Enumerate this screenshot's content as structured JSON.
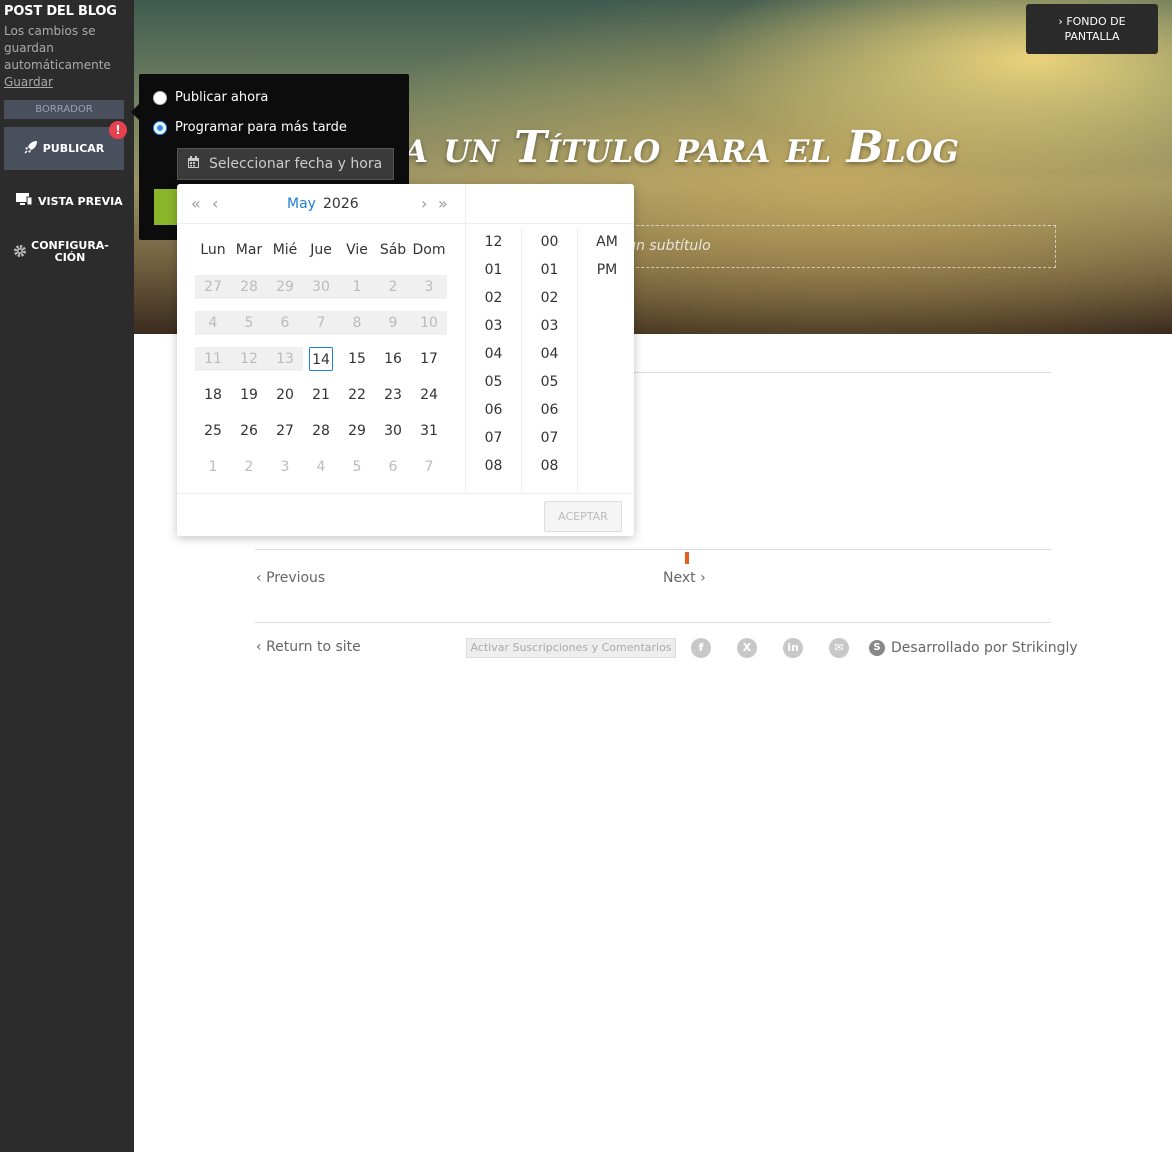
{
  "sidebar": {
    "title": "POST DEL BLOG",
    "autosave_text": "Los cambios se guardan automáticamente",
    "save_link": "Guardar",
    "draft_label": "BORRADOR",
    "publish_label": "PUBLICAR",
    "alert_badge": "!",
    "preview_label": "VISTA PREVIA",
    "config_label_1": "CONFIGURA-",
    "config_label_2": "CIÓN"
  },
  "hero": {
    "title": "a un Título para el Blog",
    "subtitle_placeholder": "r un subtítulo",
    "background_button_1": "FONDO DE",
    "background_button_2": "PANTALLA"
  },
  "post_nav": {
    "previous": "Previous",
    "next": "Next"
  },
  "footer": {
    "return_link": "Return to site",
    "activate_button": "Activar Suscripciones y Comentarios",
    "social": [
      {
        "name": "facebook-icon",
        "glyph": "f"
      },
      {
        "name": "x-icon",
        "glyph": "X"
      },
      {
        "name": "linkedin-icon",
        "glyph": "in"
      },
      {
        "name": "email-icon",
        "glyph": "✉"
      }
    ],
    "powered_by": "Desarrollado por Strikingly",
    "strikingly_logo": "S"
  },
  "publish_popover": {
    "option_now": "Publicar ahora",
    "option_later": "Programar para más tarde",
    "selected_option": "later",
    "date_placeholder": "Seleccionar fecha y hora"
  },
  "date_picker": {
    "month": "May",
    "year": "2026",
    "weekdays": [
      "Lun",
      "Mar",
      "Mié",
      "Jue",
      "Vie",
      "Sáb",
      "Dom"
    ],
    "weeks": [
      [
        [
          "27",
          "disabled"
        ],
        [
          "28",
          "disabled"
        ],
        [
          "29",
          "disabled"
        ],
        [
          "30",
          "disabled"
        ],
        [
          "1",
          "disabled"
        ],
        [
          "2",
          "disabled"
        ],
        [
          "3",
          "disabled"
        ]
      ],
      [
        [
          "4",
          "disabled"
        ],
        [
          "5",
          "disabled"
        ],
        [
          "6",
          "disabled"
        ],
        [
          "7",
          "disabled"
        ],
        [
          "8",
          "disabled"
        ],
        [
          "9",
          "disabled"
        ],
        [
          "10",
          "disabled"
        ]
      ],
      [
        [
          "11",
          "disabled"
        ],
        [
          "12",
          "disabled"
        ],
        [
          "13",
          "disabled"
        ],
        [
          "14",
          "today"
        ],
        [
          "15",
          ""
        ],
        [
          "16",
          ""
        ],
        [
          "17",
          ""
        ]
      ],
      [
        [
          "18",
          ""
        ],
        [
          "19",
          ""
        ],
        [
          "20",
          ""
        ],
        [
          "21",
          ""
        ],
        [
          "22",
          ""
        ],
        [
          "23",
          ""
        ],
        [
          "24",
          ""
        ]
      ],
      [
        [
          "25",
          ""
        ],
        [
          "26",
          ""
        ],
        [
          "27",
          ""
        ],
        [
          "28",
          ""
        ],
        [
          "29",
          ""
        ],
        [
          "30",
          ""
        ],
        [
          "31",
          ""
        ]
      ],
      [
        [
          "1",
          "other"
        ],
        [
          "2",
          "other"
        ],
        [
          "3",
          "other"
        ],
        [
          "4",
          "other"
        ],
        [
          "5",
          "other"
        ],
        [
          "6",
          "other"
        ],
        [
          "7",
          "other"
        ]
      ]
    ],
    "hours": [
      "12",
      "01",
      "02",
      "03",
      "04",
      "05",
      "06",
      "07",
      "08"
    ],
    "minutes": [
      "00",
      "01",
      "02",
      "03",
      "04",
      "05",
      "06",
      "07",
      "08"
    ],
    "meridiem": [
      "AM",
      "PM"
    ],
    "accept_label": "ACEPTAR"
  },
  "colors": {
    "sidebar_bg": "#2c2c2c",
    "accent_blue": "#1e7fd6",
    "alert_red": "#e8414d",
    "publish_green": "#8ab62a"
  }
}
